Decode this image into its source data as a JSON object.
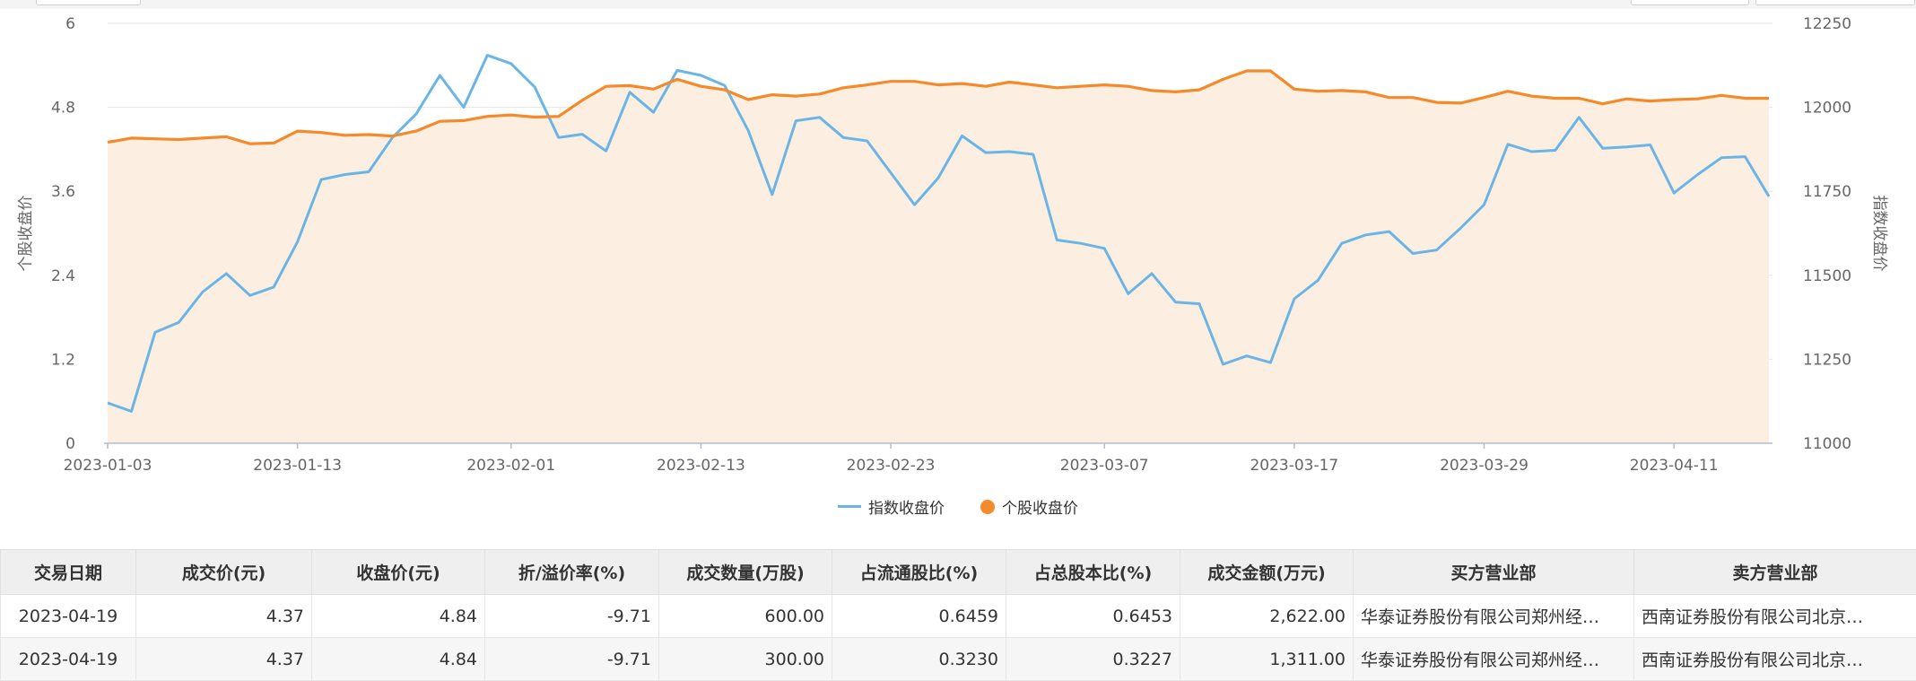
{
  "chart_data": {
    "type": "line",
    "x_tick_labels": [
      "2023-01-03",
      "2023-01-13",
      "2023-02-01",
      "2023-02-13",
      "2023-02-23",
      "2023-03-07",
      "2023-03-17",
      "2023-03-29",
      "2023-04-11"
    ],
    "left_axis": {
      "label": "个股收盘价",
      "ylim": [
        0,
        6
      ],
      "ticks": [
        "0",
        "1.2",
        "2.4",
        "3.6",
        "4.8",
        "6"
      ]
    },
    "right_axis": {
      "label": "指数收盘价",
      "ylim": [
        11000,
        12250
      ],
      "ticks": [
        "11000",
        "11250",
        "11500",
        "11750",
        "12000",
        "12250"
      ]
    },
    "grid": true,
    "legend_position": "bottom",
    "series": [
      {
        "name": "指数收盘价",
        "axis": "right",
        "color": "#6bb5e6",
        "values": [
          11120,
          11095,
          11330,
          11360,
          11450,
          11505,
          11440,
          11465,
          11600,
          11785,
          11800,
          11808,
          11910,
          11980,
          12095,
          12000,
          12155,
          12130,
          12060,
          11910,
          11920,
          11870,
          12045,
          11985,
          12110,
          12095,
          12065,
          11930,
          11740,
          11960,
          11970,
          11910,
          11900,
          11805,
          11710,
          11790,
          11915,
          11865,
          11868,
          11860,
          11605,
          11595,
          11580,
          11445,
          11505,
          11420,
          11415,
          11235,
          11260,
          11240,
          11430,
          11485,
          11595,
          11620,
          11630,
          11565,
          11575,
          11640,
          11710,
          11890,
          11868,
          11872,
          11970,
          11878,
          11882,
          11888,
          11745,
          11800,
          11850,
          11853,
          11735
        ]
      },
      {
        "name": "个股收盘价",
        "axis": "left",
        "color": "#f58a2b",
        "values": [
          4.3,
          4.36,
          4.35,
          4.34,
          4.36,
          4.38,
          4.28,
          4.29,
          4.46,
          4.44,
          4.4,
          4.41,
          4.39,
          4.46,
          4.6,
          4.61,
          4.67,
          4.69,
          4.66,
          4.67,
          4.9,
          5.1,
          5.11,
          5.06,
          5.2,
          5.1,
          5.05,
          4.91,
          4.98,
          4.96,
          4.99,
          5.08,
          5.12,
          5.17,
          5.17,
          5.12,
          5.14,
          5.1,
          5.16,
          5.12,
          5.08,
          5.1,
          5.12,
          5.1,
          5.04,
          5.02,
          5.05,
          5.2,
          5.32,
          5.32,
          5.06,
          5.03,
          5.04,
          5.02,
          4.94,
          4.94,
          4.87,
          4.86,
          4.94,
          5.03,
          4.96,
          4.93,
          4.93,
          4.85,
          4.92,
          4.89,
          4.91,
          4.92,
          4.97,
          4.93,
          4.93
        ]
      }
    ]
  },
  "table": {
    "headers": [
      "交易日期",
      "成交价(元)",
      "收盘价(元)",
      "折/溢价率(%)",
      "成交数量(万股)",
      "占流通股比(%)",
      "占总股本比(%)",
      "成交金额(万元)",
      "买方营业部",
      "卖方营业部"
    ],
    "rows": [
      [
        "2023-04-19",
        "4.37",
        "4.84",
        "-9.71",
        "600.00",
        "0.6459",
        "0.6453",
        "2,622.00",
        "华泰证券股份有限公司郑州经…",
        "西南证券股份有限公司北京…"
      ],
      [
        "2023-04-19",
        "4.37",
        "4.84",
        "-9.71",
        "300.00",
        "0.3230",
        "0.3227",
        "1,311.00",
        "华泰证券股份有限公司郑州经…",
        "西南证券股份有限公司北京…"
      ]
    ]
  }
}
